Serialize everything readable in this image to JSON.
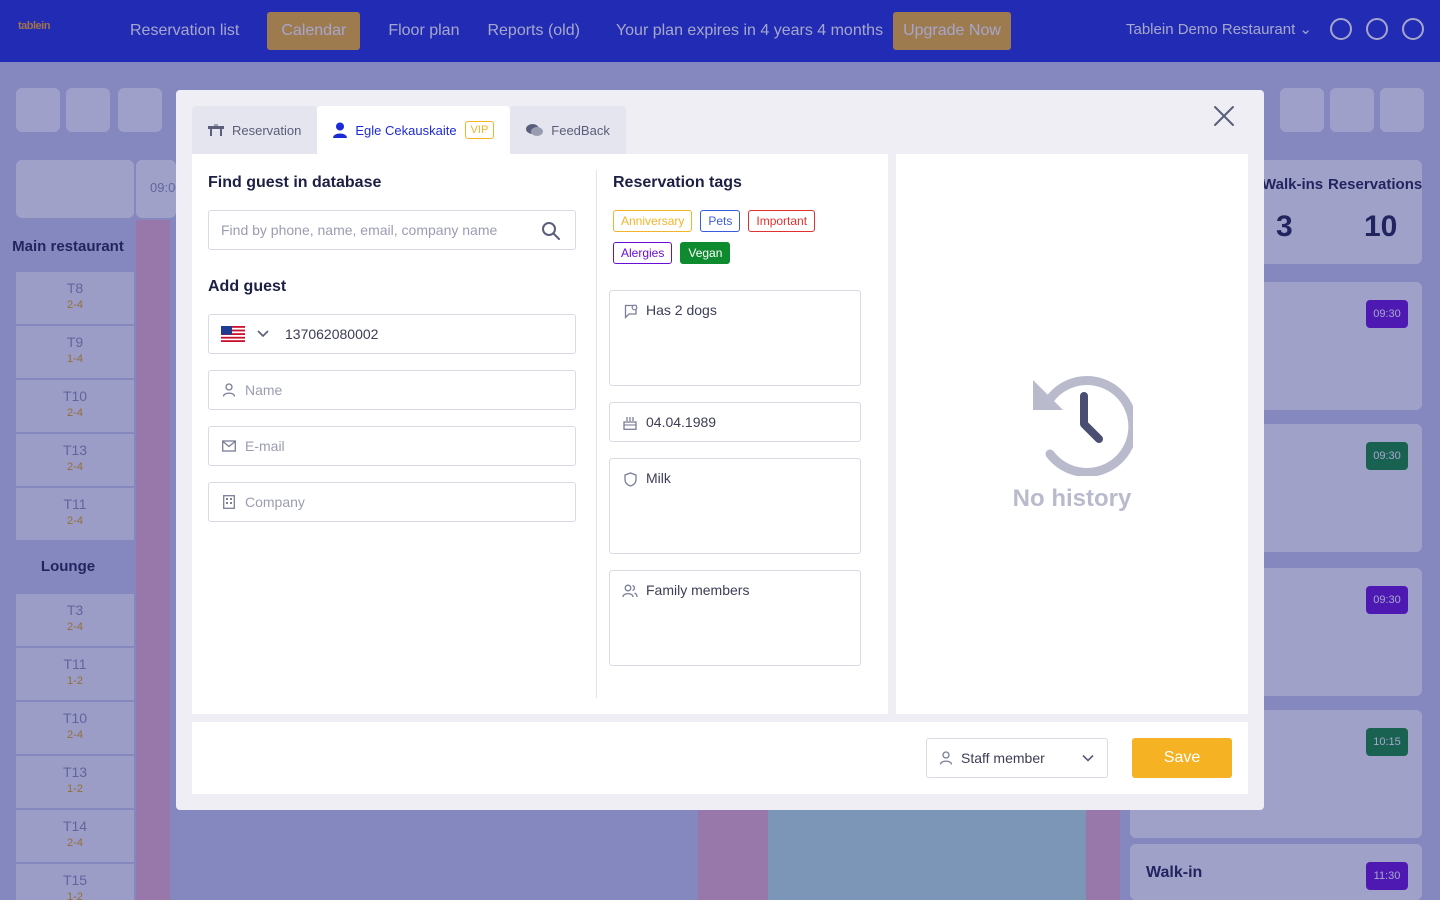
{
  "app": {
    "logo": "tablein",
    "nav": [
      "Reservation list",
      "Calendar",
      "Floor plan",
      "Reports (old)"
    ],
    "active_nav": "Calendar",
    "plan_text": "Your plan expires in 4 years 4 months",
    "upgrade_label": "Upgrade Now",
    "restaurant": "Tablein Demo Restaurant",
    "time_label": "09:00",
    "sections": [
      "Main restaurant",
      "Lounge"
    ],
    "tables_main": [
      {
        "name": "T8",
        "cap": "2-4"
      },
      {
        "name": "T9",
        "cap": "1-4"
      },
      {
        "name": "T10",
        "cap": "2-4"
      },
      {
        "name": "T13",
        "cap": "2-4"
      },
      {
        "name": "T11",
        "cap": "2-4"
      }
    ],
    "tables_lounge": [
      {
        "name": "T3",
        "cap": "2-4"
      },
      {
        "name": "T11",
        "cap": "1-2"
      },
      {
        "name": "T10",
        "cap": "2-4"
      },
      {
        "name": "T13",
        "cap": "1-2"
      },
      {
        "name": "T14",
        "cap": "2-4"
      },
      {
        "name": "T15",
        "cap": "1-2"
      }
    ],
    "stats": {
      "walkins_label": "Walk-ins",
      "walkins_value": "3",
      "reservations_label": "Reservations",
      "reservations_value": "10"
    },
    "card_times": [
      "09:30",
      "09:30",
      "09:30",
      "10:15",
      "11:30"
    ],
    "walkin_card_label": "Walk-in",
    "colors": {
      "primary": "#1c2bd6",
      "accent": "#f3b32a",
      "purple": "#6a0dd6",
      "green": "#0e8a2f"
    }
  },
  "modal": {
    "tabs": [
      {
        "label": "Reservation",
        "icon": "table-icon"
      },
      {
        "label": "Egle Cekauskaite",
        "icon": "user-icon",
        "badge": "VIP"
      },
      {
        "label": "FeedBack",
        "icon": "chat-icon"
      }
    ],
    "find_guest": {
      "title": "Find guest in database",
      "placeholder": "Find by phone, name, email, company name"
    },
    "add_guest": {
      "title": "Add guest",
      "phone_value": "137062080002",
      "name_placeholder": "Name",
      "email_placeholder": "E-mail",
      "company_placeholder": "Company"
    },
    "reservation_tags": {
      "title": "Reservation tags",
      "tags": [
        {
          "label": "Anniversary",
          "color": "#f3b32a",
          "filled": false
        },
        {
          "label": "Pets",
          "color": "#3b5bdb",
          "filled": false
        },
        {
          "label": "Important",
          "color": "#e03131",
          "filled": false
        },
        {
          "label": "Alergies",
          "color": "#6a0dd6",
          "filled": false
        },
        {
          "label": "Vegan",
          "color": "#0e8a2f",
          "filled": true
        }
      ]
    },
    "notes": {
      "note": "Has 2 dogs",
      "birthday": "04.04.1989",
      "allergies": "Milk",
      "family": "Family members"
    },
    "history": {
      "empty_text": "No history"
    },
    "footer": {
      "staff_label": "Staff member",
      "save_label": "Save"
    }
  }
}
